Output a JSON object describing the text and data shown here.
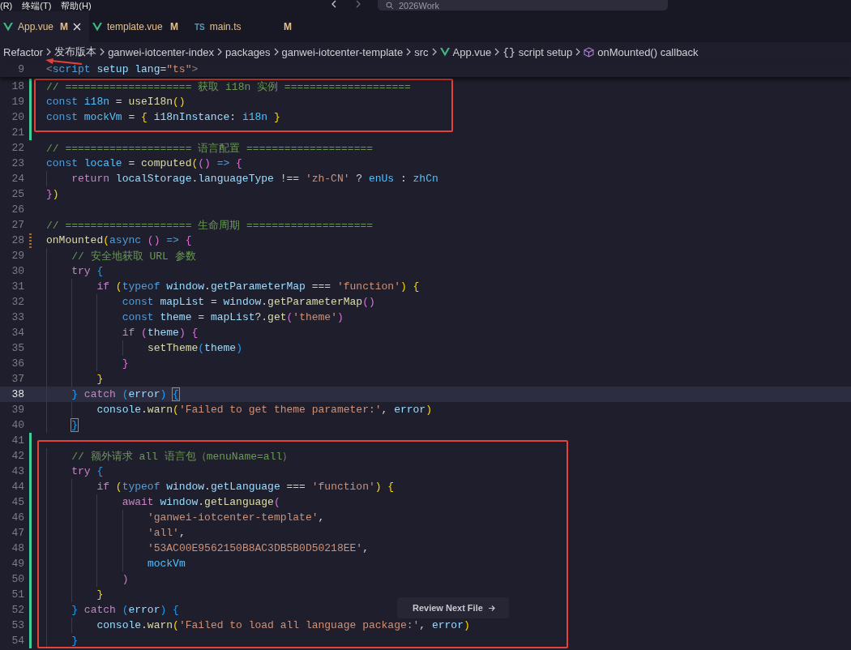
{
  "menu": [
    {
      "label": "(R)"
    },
    {
      "label": "终端(T)"
    },
    {
      "label": "帮助(H)"
    }
  ],
  "command_center": {
    "text": "2026Work"
  },
  "tabs": [
    {
      "label": "App.vue",
      "kind": "vue",
      "status": "M",
      "selected": true
    },
    {
      "label": "template.vue",
      "kind": "vue",
      "status": "M",
      "selected": false
    },
    {
      "label": "main.ts",
      "kind": "ts",
      "badge": "TS",
      "status": "M",
      "selected": false
    }
  ],
  "breadcrumb": [
    {
      "label": "Refactor",
      "kind": "text"
    },
    {
      "label": "发布版本",
      "kind": "text"
    },
    {
      "label": "ganwei-iotcenter-index",
      "kind": "text"
    },
    {
      "label": "packages",
      "kind": "text"
    },
    {
      "label": "ganwei-iotcenter-template",
      "kind": "text"
    },
    {
      "label": "src",
      "kind": "text"
    },
    {
      "label": "App.vue",
      "kind": "vue"
    },
    {
      "label": "script setup",
      "kind": "symbol",
      "icon": "{}"
    },
    {
      "label": "onMounted() callback",
      "kind": "method"
    }
  ],
  "sticky_line": {
    "number": "9",
    "tokens": [
      {
        "t": "<",
        "kind": "tag"
      },
      {
        "t": "script ",
        "kind": "kw"
      },
      {
        "t": "setup ",
        "kind": "var"
      },
      {
        "t": "lang",
        "kind": "var"
      },
      {
        "t": "=",
        "kind": "p"
      },
      {
        "t": "\"ts\"",
        "kind": "str"
      },
      {
        "t": ">",
        "kind": "tag"
      }
    ]
  },
  "blocks": [
    {
      "framed": true,
      "lines": [
        {
          "n": "18",
          "gutter": {
            "kind": "added"
          },
          "current": false,
          "tokens": [
            {
              "t": "// ==================== 获取 i18n 实例 ====================",
              "kind": "cmt"
            }
          ]
        },
        {
          "n": "19",
          "gutter": {
            "kind": "added"
          },
          "current": false,
          "tokens": [
            {
              "t": "const ",
              "kind": "kw"
            },
            {
              "t": "i18n",
              "kind": "cst"
            },
            {
              "t": " = ",
              "kind": "p"
            },
            {
              "t": "useI18n",
              "kind": "fn"
            },
            {
              "t": "()",
              "kind": "b1"
            }
          ]
        },
        {
          "n": "20",
          "gutter": {
            "kind": "added"
          },
          "current": false,
          "tokens": [
            {
              "t": "const ",
              "kind": "kw"
            },
            {
              "t": "mockVm",
              "kind": "cst"
            },
            {
              "t": " = ",
              "kind": "p"
            },
            {
              "t": "{ ",
              "kind": "b1"
            },
            {
              "t": "i18nInstance",
              "kind": "var"
            },
            {
              "t": ": ",
              "kind": "p"
            },
            {
              "t": "i18n",
              "kind": "cst"
            },
            {
              "t": " }",
              "kind": "b1"
            }
          ]
        },
        {
          "n": "21",
          "gutter": {
            "kind": "added"
          },
          "current": false
        }
      ]
    },
    {
      "framed": false,
      "lines": [
        {
          "n": "22",
          "current": false,
          "tokens": [
            {
              "t": "// ==================== 语言配置 ====================",
              "kind": "cmt"
            }
          ]
        },
        {
          "n": "23",
          "current": false,
          "tokens": [
            {
              "t": "const ",
              "kind": "kw"
            },
            {
              "t": "locale",
              "kind": "cst"
            },
            {
              "t": " = ",
              "kind": "p"
            },
            {
              "t": "computed",
              "kind": "fn"
            },
            {
              "t": "(",
              "kind": "b1"
            },
            {
              "t": "()",
              "kind": "b2"
            },
            {
              "t": " => ",
              "kind": "kw"
            },
            {
              "t": "{",
              "kind": "b2"
            }
          ]
        },
        {
          "n": "24",
          "current": false,
          "tokens": [
            {
              "t": "    return ",
              "kind": "ctl"
            },
            {
              "t": "localStorage",
              "kind": "var"
            },
            {
              "t": ".",
              "kind": "p"
            },
            {
              "t": "languageType",
              "kind": "var"
            },
            {
              "t": " !== ",
              "kind": "p"
            },
            {
              "t": "'zh-CN'",
              "kind": "str"
            },
            {
              "t": " ? ",
              "kind": "p"
            },
            {
              "t": "enUs",
              "kind": "cst"
            },
            {
              "t": " : ",
              "kind": "p"
            },
            {
              "t": "zhCn",
              "kind": "cst"
            }
          ]
        },
        {
          "n": "25",
          "current": false,
          "tokens": [
            {
              "t": "}",
              "kind": "b2"
            },
            {
              "t": ")",
              "kind": "b1"
            }
          ]
        },
        {
          "n": "26",
          "current": false
        },
        {
          "n": "27",
          "current": false,
          "tokens": [
            {
              "t": "// ==================== 生命周期 ====================",
              "kind": "cmt"
            }
          ]
        },
        {
          "n": "28",
          "gutter": {
            "kind": "modified"
          },
          "current": false,
          "tokens": [
            {
              "t": "onMounted",
              "kind": "fn"
            },
            {
              "t": "(",
              "kind": "b1"
            },
            {
              "t": "async ",
              "kind": "kw"
            },
            {
              "t": "()",
              "kind": "b2"
            },
            {
              "t": " => ",
              "kind": "kw"
            },
            {
              "t": "{",
              "kind": "b2"
            }
          ]
        },
        {
          "n": "29",
          "current": false,
          "tokens": [
            {
              "t": "    // 安全地获取 URL 参数",
              "kind": "cmt"
            }
          ]
        },
        {
          "n": "30",
          "current": false,
          "tokens": [
            {
              "t": "    try ",
              "kind": "ctl"
            },
            {
              "t": "{",
              "kind": "b3"
            }
          ]
        },
        {
          "n": "31",
          "current": false,
          "tokens": [
            {
              "t": "        if ",
              "kind": "ctl"
            },
            {
              "t": "(",
              "kind": "b1"
            },
            {
              "t": "typeof ",
              "kind": "kw"
            },
            {
              "t": "window",
              "kind": "var"
            },
            {
              "t": ".",
              "kind": "p"
            },
            {
              "t": "getParameterMap",
              "kind": "var"
            },
            {
              "t": " === ",
              "kind": "p"
            },
            {
              "t": "'function'",
              "kind": "str"
            },
            {
              "t": ")",
              "kind": "b1"
            },
            {
              "t": " {",
              "kind": "b1"
            }
          ]
        },
        {
          "n": "32",
          "current": false,
          "tokens": [
            {
              "t": "            const ",
              "kind": "kw"
            },
            {
              "t": "mapList",
              "kind": "var"
            },
            {
              "t": " = ",
              "kind": "p"
            },
            {
              "t": "window",
              "kind": "var"
            },
            {
              "t": ".",
              "kind": "p"
            },
            {
              "t": "getParameterMap",
              "kind": "fn"
            },
            {
              "t": "()",
              "kind": "b2"
            }
          ]
        },
        {
          "n": "33",
          "current": false,
          "tokens": [
            {
              "t": "            const ",
              "kind": "kw"
            },
            {
              "t": "theme",
              "kind": "var"
            },
            {
              "t": " = ",
              "kind": "p"
            },
            {
              "t": "mapList",
              "kind": "var"
            },
            {
              "t": "?.",
              "kind": "p"
            },
            {
              "t": "get",
              "kind": "fn"
            },
            {
              "t": "(",
              "kind": "b2"
            },
            {
              "t": "'theme'",
              "kind": "str"
            },
            {
              "t": ")",
              "kind": "b2"
            }
          ]
        },
        {
          "n": "34",
          "current": false,
          "tokens": [
            {
              "t": "            if ",
              "kind": "ctl"
            },
            {
              "t": "(",
              "kind": "b2"
            },
            {
              "t": "theme",
              "kind": "var"
            },
            {
              "t": ")",
              "kind": "b2"
            },
            {
              "t": " {",
              "kind": "b2"
            }
          ]
        },
        {
          "n": "35",
          "current": false,
          "tokens": [
            {
              "t": "                setTheme",
              "kind": "fn"
            },
            {
              "t": "(",
              "kind": "b3"
            },
            {
              "t": "theme",
              "kind": "var"
            },
            {
              "t": ")",
              "kind": "b3"
            }
          ]
        },
        {
          "n": "36",
          "current": false,
          "tokens": [
            {
              "t": "            }",
              "kind": "b2"
            }
          ]
        },
        {
          "n": "37",
          "current": false,
          "tokens": [
            {
              "t": "        }",
              "kind": "b1"
            }
          ]
        },
        {
          "n": "38",
          "current": true,
          "tokens": [
            {
              "t": "    } ",
              "kind": "b3"
            },
            {
              "t": "catch ",
              "kind": "ctl"
            },
            {
              "t": "(",
              "kind": "b3"
            },
            {
              "t": "error",
              "kind": "var"
            },
            {
              "t": ") ",
              "kind": "b3"
            },
            {
              "t": "{",
              "kind": "b3",
              "matched": true
            }
          ]
        },
        {
          "n": "39",
          "current": false,
          "tokens": [
            {
              "t": "        console",
              "kind": "var"
            },
            {
              "t": ".",
              "kind": "p"
            },
            {
              "t": "warn",
              "kind": "fn"
            },
            {
              "t": "(",
              "kind": "b1"
            },
            {
              "t": "'Failed to get theme parameter:'",
              "kind": "str"
            },
            {
              "t": ", ",
              "kind": "p"
            },
            {
              "t": "error",
              "kind": "var"
            },
            {
              "t": ")",
              "kind": "b1"
            }
          ]
        },
        {
          "n": "40",
          "current": false,
          "tokens": [
            {
              "t": "    }",
              "kind": "b3",
              "matched": true
            }
          ]
        },
        {
          "n": "41",
          "gutter": {
            "kind": "added"
          },
          "current": false
        }
      ]
    },
    {
      "framed": true,
      "lines": [
        {
          "n": "42",
          "gutter": {
            "kind": "added"
          },
          "current": false,
          "tokens": [
            {
              "t": "    // 额外请求 all 语言包（menuName=all）",
              "kind": "cmt"
            }
          ]
        },
        {
          "n": "43",
          "gutter": {
            "kind": "added"
          },
          "current": false,
          "tokens": [
            {
              "t": "    try ",
              "kind": "ctl"
            },
            {
              "t": "{",
              "kind": "b3"
            }
          ]
        },
        {
          "n": "44",
          "gutter": {
            "kind": "added"
          },
          "current": false,
          "tokens": [
            {
              "t": "        if ",
              "kind": "ctl"
            },
            {
              "t": "(",
              "kind": "b1"
            },
            {
              "t": "typeof ",
              "kind": "kw"
            },
            {
              "t": "window",
              "kind": "var"
            },
            {
              "t": ".",
              "kind": "p"
            },
            {
              "t": "getLanguage",
              "kind": "var"
            },
            {
              "t": " === ",
              "kind": "p"
            },
            {
              "t": "'function'",
              "kind": "str"
            },
            {
              "t": ")",
              "kind": "b1"
            },
            {
              "t": " {",
              "kind": "b1"
            }
          ]
        },
        {
          "n": "45",
          "gutter": {
            "kind": "added"
          },
          "current": false,
          "tokens": [
            {
              "t": "            await ",
              "kind": "ctl"
            },
            {
              "t": "window",
              "kind": "var"
            },
            {
              "t": ".",
              "kind": "p"
            },
            {
              "t": "getLanguage",
              "kind": "fn"
            },
            {
              "t": "(",
              "kind": "b2"
            }
          ]
        },
        {
          "n": "46",
          "gutter": {
            "kind": "added"
          },
          "current": false,
          "tokens": [
            {
              "t": "                'ganwei-iotcenter-template'",
              "kind": "str"
            },
            {
              "t": ",",
              "kind": "p"
            }
          ]
        },
        {
          "n": "47",
          "gutter": {
            "kind": "added"
          },
          "current": false,
          "tokens": [
            {
              "t": "                'all'",
              "kind": "str"
            },
            {
              "t": ",",
              "kind": "p"
            }
          ]
        },
        {
          "n": "48",
          "gutter": {
            "kind": "added"
          },
          "current": false,
          "tokens": [
            {
              "t": "                '53AC00E9562150B8AC3DB5B0D50218EE'",
              "kind": "str"
            },
            {
              "t": ",",
              "kind": "p"
            }
          ]
        },
        {
          "n": "49",
          "gutter": {
            "kind": "added"
          },
          "current": false,
          "tokens": [
            {
              "t": "                mockVm",
              "kind": "cst"
            }
          ]
        },
        {
          "n": "50",
          "gutter": {
            "kind": "added"
          },
          "current": false,
          "tokens": [
            {
              "t": "            )",
              "kind": "b2"
            }
          ]
        },
        {
          "n": "51",
          "gutter": {
            "kind": "added"
          },
          "current": false,
          "tokens": [
            {
              "t": "        }",
              "kind": "b1"
            }
          ]
        },
        {
          "n": "52",
          "gutter": {
            "kind": "added"
          },
          "current": false,
          "tokens": [
            {
              "t": "    } ",
              "kind": "b3"
            },
            {
              "t": "catch ",
              "kind": "ctl"
            },
            {
              "t": "(",
              "kind": "b3"
            },
            {
              "t": "error",
              "kind": "var"
            },
            {
              "t": ") ",
              "kind": "b3"
            },
            {
              "t": "{",
              "kind": "b3"
            }
          ]
        },
        {
          "n": "53",
          "gutter": {
            "kind": "added"
          },
          "current": false,
          "tokens": [
            {
              "t": "        console",
              "kind": "var"
            },
            {
              "t": ".",
              "kind": "p"
            },
            {
              "t": "warn",
              "kind": "fn"
            },
            {
              "t": "(",
              "kind": "b1"
            },
            {
              "t": "'Failed to load all language package:'",
              "kind": "str"
            },
            {
              "t": ", ",
              "kind": "p"
            },
            {
              "t": "error",
              "kind": "var"
            },
            {
              "t": ")",
              "kind": "b1"
            }
          ]
        },
        {
          "n": "54",
          "gutter": {
            "kind": "added"
          },
          "current": false,
          "tokens": [
            {
              "t": "    }",
              "kind": "b3"
            }
          ]
        }
      ]
    }
  ],
  "review_button": {
    "label": "Review Next File"
  }
}
